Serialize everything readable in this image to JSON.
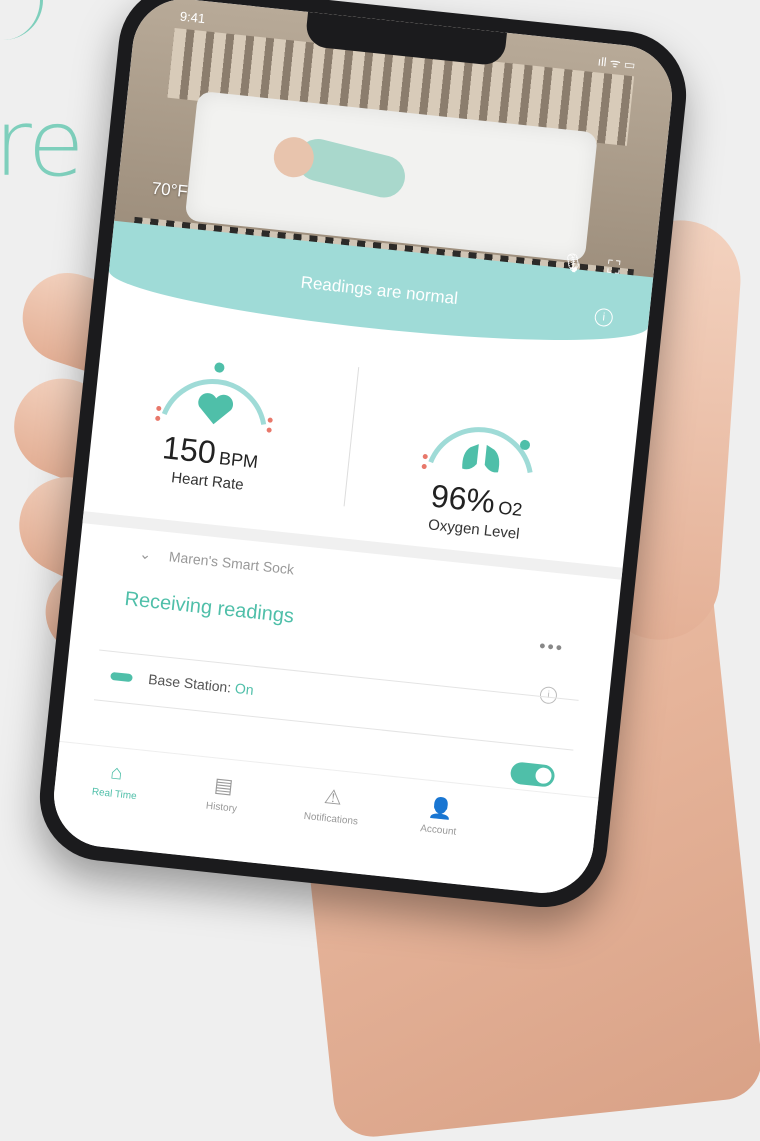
{
  "background": {
    "text": "re"
  },
  "status_bar": {
    "time": "9:41",
    "icons": "ıll ᯤ ▭"
  },
  "video": {
    "temperature": "70°F",
    "mic_icon": "mic-icon",
    "fullscreen_icon": "fullscreen-icon"
  },
  "banner": {
    "text": "Readings are normal"
  },
  "heart_rate": {
    "value": "150",
    "unit": "BPM",
    "label": "Heart Rate"
  },
  "oxygen": {
    "value": "96%",
    "unit": "O2",
    "label": "Oxygen Level"
  },
  "device": {
    "name": "Maren's Smart Sock",
    "status": "Receiving readings",
    "more": "•••",
    "base_station_label": "Base Station:",
    "base_station_value": "On"
  },
  "tabs": [
    {
      "label": "Real Time",
      "icon": "home-icon"
    },
    {
      "label": "History",
      "icon": "history-icon"
    },
    {
      "label": "Notifications",
      "icon": "warning-icon"
    },
    {
      "label": "Account",
      "icon": "account-icon"
    }
  ],
  "colors": {
    "accent": "#4fbfa9",
    "banner": "#9fdbd7",
    "alert": "#e8786b"
  }
}
